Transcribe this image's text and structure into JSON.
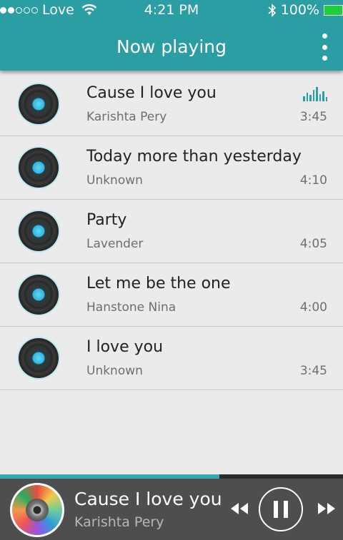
{
  "status_bar": {
    "carrier": "Love",
    "time": "4:21 PM",
    "battery": "100%"
  },
  "header": {
    "title": "Now playing"
  },
  "songs": [
    {
      "title": "Cause I love you",
      "artist": "Karishta Pery",
      "duration": "3:45",
      "playing": true
    },
    {
      "title": "Today more than yesterday",
      "artist": "Unknown",
      "duration": "4:10"
    },
    {
      "title": "Party",
      "artist": "Lavender",
      "duration": "4:05"
    },
    {
      "title": "Let me be the one",
      "artist": "Hanstone Nina",
      "duration": "4:00"
    },
    {
      "title": "I love you",
      "artist": "Unknown",
      "duration": "3:45"
    }
  ],
  "player": {
    "title": "Cause I love you",
    "artist": "Karishta Pery",
    "progress": 0.64
  },
  "colors": {
    "accent": "#2b9ea3",
    "player_bg": "#4e4e4e",
    "battery": "#1fcf3a"
  }
}
